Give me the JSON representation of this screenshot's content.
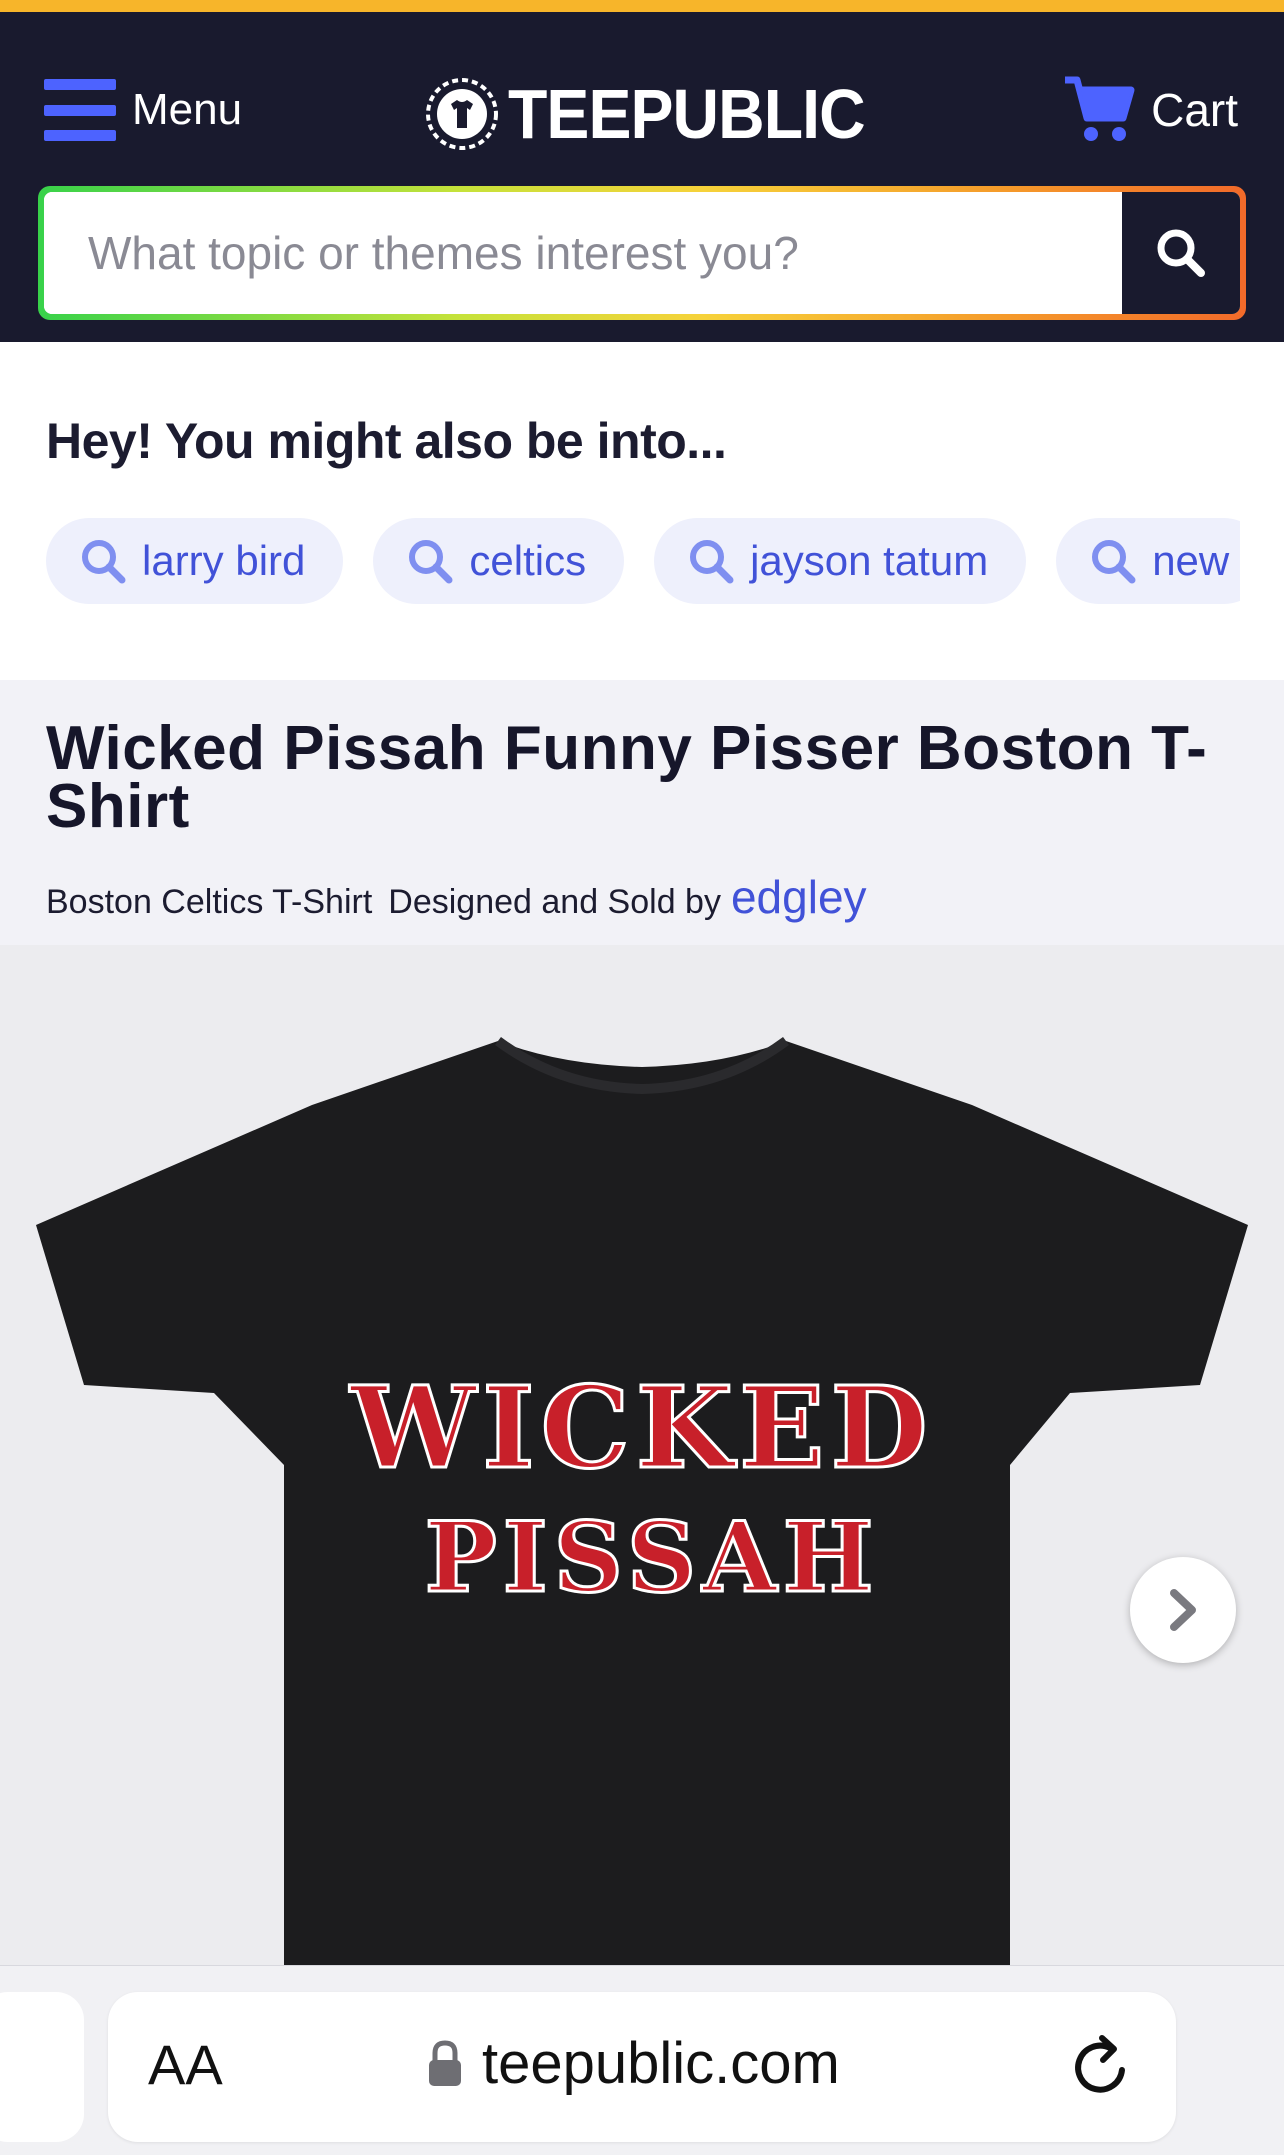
{
  "header": {
    "menu_label": "Menu",
    "logo_text": "TEEPUBLIC",
    "cart_label": "Cart"
  },
  "search": {
    "placeholder": "What topic or themes interest you?",
    "value": ""
  },
  "suggestions": {
    "title": "Hey! You might also be into...",
    "chips": [
      {
        "label": "larry bird"
      },
      {
        "label": "celtics"
      },
      {
        "label": "jayson tatum"
      },
      {
        "label": "new"
      }
    ]
  },
  "product": {
    "title": "Wicked Pissah Funny Pisser Boston T-Shirt",
    "category": "Boston Celtics T-Shirt",
    "designed_by_prefix": "Designed and Sold by",
    "artist": "edgley",
    "shirt_print_line1": "WICKED",
    "shirt_print_line2": "PISSAH"
  },
  "browser": {
    "aa_label": "AA",
    "url": "teepublic.com"
  },
  "colors": {
    "accent": "#4d63ff",
    "header_bg": "#191a2e",
    "top_stripe": "#f7b52a",
    "link": "#4152d8",
    "shirt_print": "#c8202a"
  },
  "icons": {
    "menu": "hamburger-icon",
    "logo": "tshirt-laurel-icon",
    "cart": "cart-icon",
    "search": "search-icon",
    "next": "chevron-right-icon",
    "lock": "lock-icon",
    "reload": "reload-icon"
  }
}
